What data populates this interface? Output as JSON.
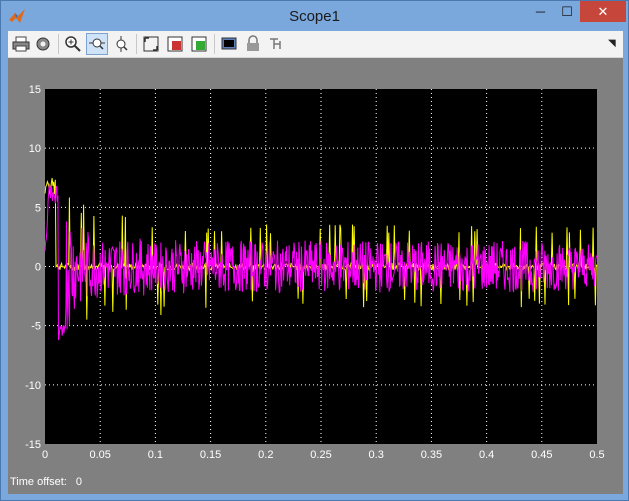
{
  "window": {
    "title": "Scope1"
  },
  "toolbar": {
    "items": [
      {
        "name": "print-icon"
      },
      {
        "name": "parameters-gear-icon"
      },
      {
        "name": "zoom-in-icon"
      },
      {
        "name": "zoom-x-axis-icon",
        "active": true
      },
      {
        "name": "zoom-y-axis-icon"
      },
      {
        "name": "autoscale-icon"
      },
      {
        "name": "save-axes-settings-icon"
      },
      {
        "name": "restore-axes-settings-icon"
      },
      {
        "name": "floating-scope-icon"
      },
      {
        "name": "lock-axes-icon"
      },
      {
        "name": "signal-selector-icon"
      }
    ],
    "menu_glyph": "◥"
  },
  "status": {
    "label": "Time offset:",
    "value": "0"
  },
  "colors": {
    "plot_bg": "#000000",
    "frame_bg": "#808080",
    "series_1": "#ffff00",
    "series_2": "#ff00ff",
    "grid": "#ffffff"
  },
  "chart_data": {
    "type": "line",
    "xlim": [
      0,
      0.5
    ],
    "ylim": [
      -15,
      15
    ],
    "x_ticks": [
      "0",
      "0.05",
      "0.1",
      "0.15",
      "0.2",
      "0.25",
      "0.3",
      "0.35",
      "0.4",
      "0.45",
      "0.5"
    ],
    "y_ticks": [
      "15",
      "10",
      "5",
      "0",
      "-5",
      "-10",
      "-15"
    ],
    "grid": true,
    "series": [
      {
        "color": "#ffff00",
        "style": "spikes",
        "x": [
          0.0,
          0.008,
          0.012,
          0.02,
          0.025,
          0.031,
          0.036,
          0.042,
          0.048,
          0.055,
          0.065,
          0.08,
          0.1,
          0.13,
          0.16,
          0.2,
          0.25,
          0.3,
          0.35,
          0.4,
          0.45,
          0.5
        ],
        "y": [
          2,
          7.5,
          6,
          -6,
          5.5,
          5,
          -5,
          4.5,
          -4,
          3,
          -4,
          3.5,
          -3.5,
          3,
          -3,
          3,
          -3,
          3,
          -3,
          3,
          -3,
          3
        ]
      },
      {
        "color": "#ff00ff",
        "style": "noise",
        "x": [
          0.0,
          0.004,
          0.008,
          0.012,
          0.016,
          0.02,
          0.024,
          0.028,
          0.032,
          0.036,
          0.04,
          0.044,
          0.048,
          0.052,
          0.06,
          0.07,
          0.08,
          0.09,
          0.1,
          0.12,
          0.15,
          0.2,
          0.25,
          0.3,
          0.35,
          0.4,
          0.45,
          0.5
        ],
        "y": [
          1,
          7.2,
          6.5,
          -6.2,
          -5.5,
          5.8,
          4.5,
          -3.5,
          3.5,
          -3,
          3.2,
          -2.5,
          2.8,
          -2.2,
          2.5,
          -2.5,
          2.2,
          -2.5,
          2,
          -2.3,
          2.2,
          -2.2,
          2.2,
          -2.2,
          2.2,
          -2.2,
          2.2,
          -1.8
        ]
      }
    ]
  }
}
